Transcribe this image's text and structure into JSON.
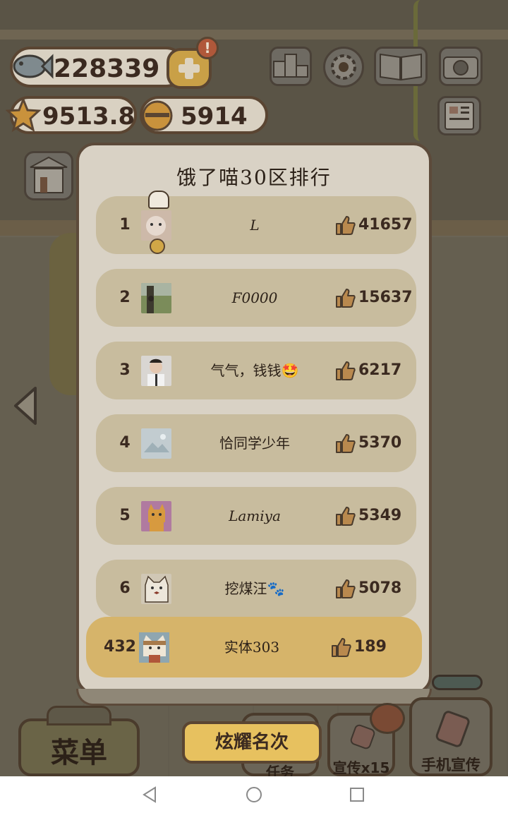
{
  "hud": {
    "fish_count": "228339",
    "star_value": "9513.8",
    "bell_count": "5914",
    "alert_mark": "!"
  },
  "leaderboard": {
    "title": "饿了喵30区排行",
    "entries": [
      {
        "rank": "1",
        "name": "L",
        "likes": "41657"
      },
      {
        "rank": "2",
        "name": "F0000",
        "likes": "15637"
      },
      {
        "rank": "3",
        "name": "气气，钱钱🤩",
        "likes": "6217"
      },
      {
        "rank": "4",
        "name": "恰同学少年",
        "likes": "5370"
      },
      {
        "rank": "5",
        "name": "Lamiya",
        "likes": "5349"
      },
      {
        "rank": "6",
        "name": "挖煤汪🐾",
        "likes": "5078"
      }
    ],
    "me": {
      "rank": "432",
      "name": "实体303",
      "likes": "189"
    },
    "show_button": "炫耀名次"
  },
  "bottom_bar": {
    "menu": "菜单",
    "task": "任务",
    "promote": "宣传x15",
    "phone_promote": "手机宣传"
  },
  "colors": {
    "panel_bg": "#d9d2c5",
    "row_bg": "#c8bc9e",
    "my_row_bg": "#d6b46a",
    "accent_gold": "#e7c15f",
    "text_dark": "#3b2a20"
  },
  "icons": [
    "fish-icon",
    "plus-icon",
    "star-icon",
    "bell-icon",
    "ranking-icon",
    "gear-icon",
    "book-icon",
    "camera-icon",
    "news-icon",
    "shop-icon",
    "arrow-left-icon",
    "thumbs-up-icon",
    "nav-back-icon",
    "nav-home-icon",
    "nav-recent-icon"
  ]
}
